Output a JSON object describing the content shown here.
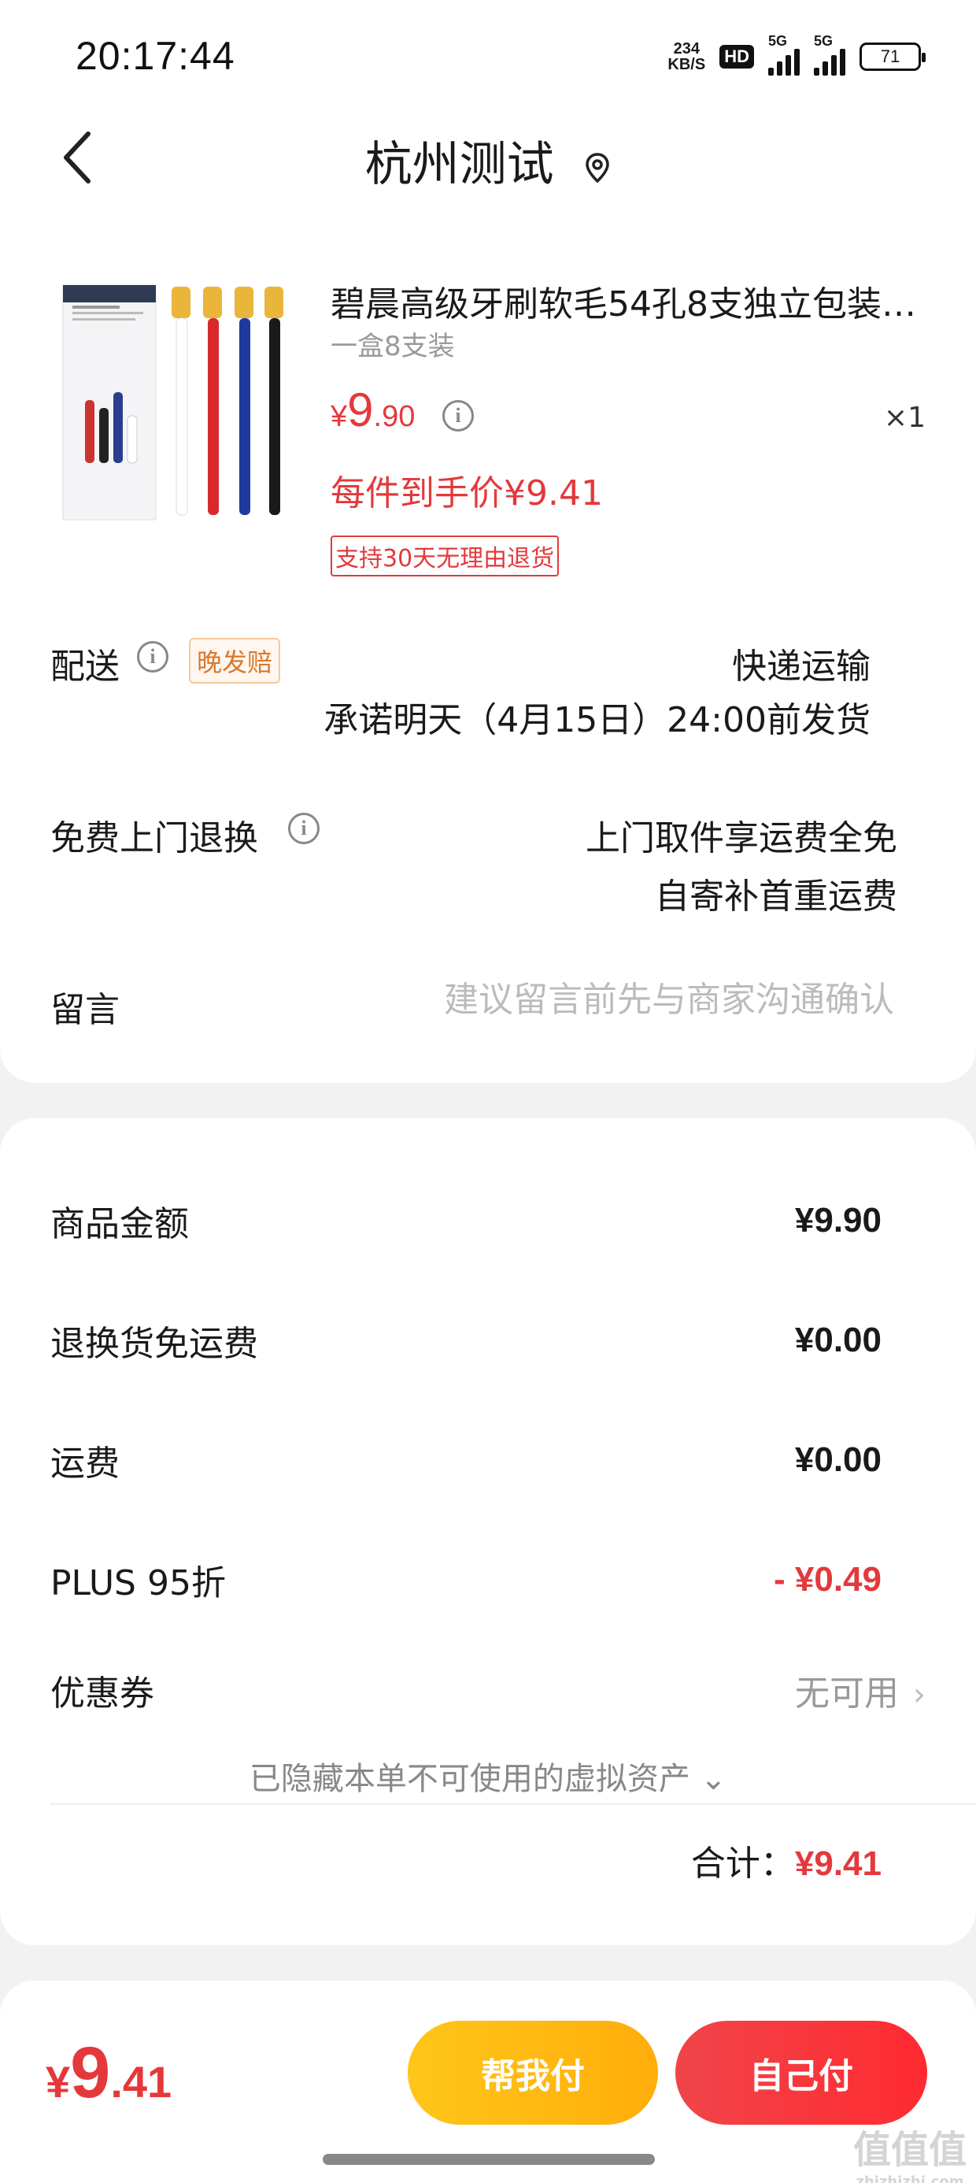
{
  "status": {
    "time": "20:17:44",
    "net_speed_top": "234",
    "net_speed_bottom": "KB/S",
    "hd": "HD",
    "sig1": "5G",
    "sig2": "5G",
    "battery": "71"
  },
  "header": {
    "title": "杭州测试"
  },
  "product": {
    "name": "碧晨高级牙刷软毛54孔8支独立包装…",
    "spec": "一盒8支装",
    "price_currency": "¥",
    "price_int": "9",
    "price_dec": ".90",
    "quantity": "×1",
    "hand_price": "每件到手价¥9.41",
    "return_tag": "支持30天无理由退货",
    "info_glyph": "i"
  },
  "delivery": {
    "label": "配送",
    "late_tag": "晚发赔",
    "method": "快递运输",
    "promise": "承诺明天（4月15日）24:00前发货"
  },
  "free_return": {
    "label": "免费上门退换",
    "line1": "上门取件享运费全免",
    "line2": "自寄补首重运费"
  },
  "message": {
    "label": "留言",
    "placeholder": "建议留言前先与商家沟通确认",
    "value": ""
  },
  "amounts": {
    "goods_label": "商品金额",
    "goods_value": "¥9.90",
    "return_ship_label": "退换货免运费",
    "return_ship_value": "¥0.00",
    "shipping_label": "运费",
    "shipping_value": "¥0.00",
    "plus_label": "PLUS 95折",
    "plus_value": "- ¥0.49",
    "coupon_label": "优惠券",
    "coupon_value": "无可用",
    "chevron": "›",
    "hidden_assets": "已隐藏本单不可使用的虚拟资产",
    "hidden_chevron": "⌄",
    "total_label": "合计：",
    "total_value": "¥9.41"
  },
  "footer": {
    "price_currency": "¥",
    "price_int": "9",
    "price_dec": ".41",
    "help_pay": "帮我付",
    "self_pay": "自己付"
  },
  "watermark": {
    "main": "值值值",
    "small": "zhizhizhi.com"
  },
  "colors": {
    "accent_red": "#e4393c",
    "help_yellow": "#ffb915",
    "self_red": "#f4383c"
  }
}
